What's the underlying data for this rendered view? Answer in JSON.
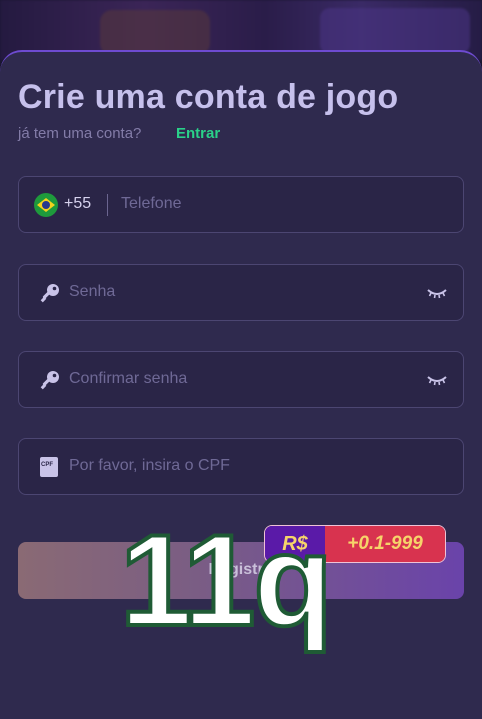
{
  "form": {
    "title": "Crie uma conta de jogo",
    "subtitle": "já tem uma conta?",
    "login_link": "Entrar",
    "phone": {
      "country_code": "+55",
      "placeholder": "Telefone",
      "flag": "brazil-flag-icon"
    },
    "password": {
      "placeholder": "Senha",
      "icon": "key-icon",
      "toggle_icon": "eye-closed-icon"
    },
    "confirm_password": {
      "placeholder": "Confirmar senha",
      "icon": "key-icon",
      "toggle_icon": "eye-closed-icon"
    },
    "cpf": {
      "placeholder": "Por favor, insira o CPF",
      "icon": "cpf-card-icon",
      "icon_text": "CPF"
    },
    "register_button": "Registro"
  },
  "bonus_badge": {
    "currency": "R$",
    "amount": "+0.1-999"
  },
  "overlay": {
    "text": "11q"
  },
  "colors": {
    "accent": "#2ad189",
    "modal_bg": "#2f2a4e",
    "border": "#6e4bd1"
  }
}
